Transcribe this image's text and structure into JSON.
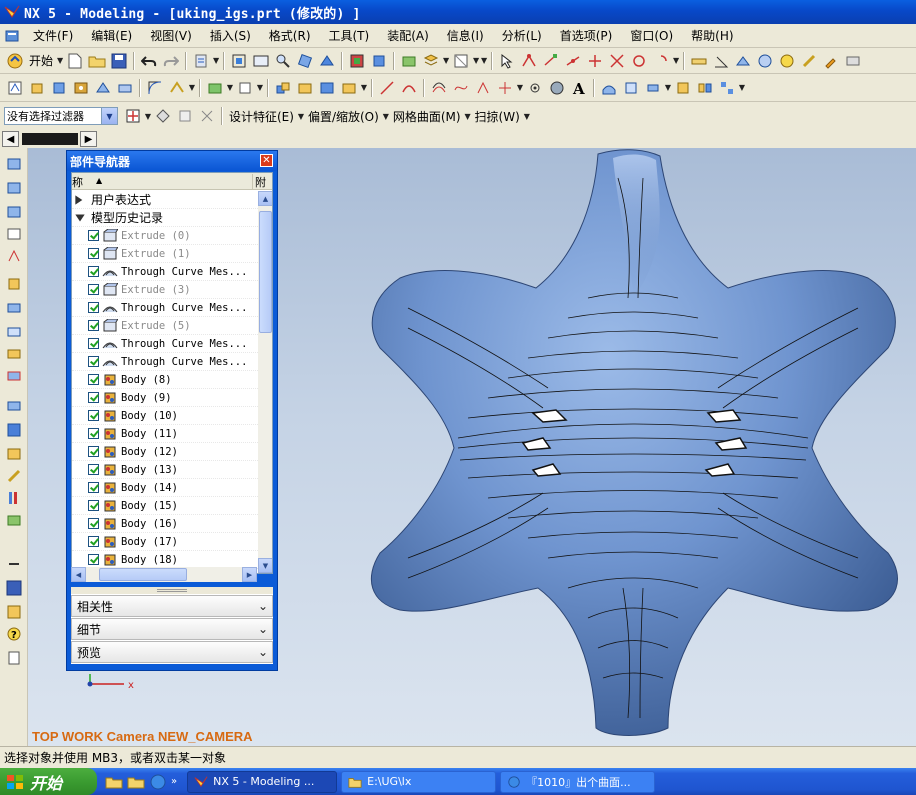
{
  "window": {
    "title": "NX 5 - Modeling - [uking_igs.prt  (修改的) ]"
  },
  "menubar": {
    "items": [
      "文件(F)",
      "编辑(E)",
      "视图(V)",
      "插入(S)",
      "格式(R)",
      "工具(T)",
      "装配(A)",
      "信息(I)",
      "分析(L)",
      "首选项(P)",
      "窗口(O)",
      "帮助(H)"
    ]
  },
  "toolbar2": {
    "start_label": "开始"
  },
  "toolbar4": {
    "filter_value": "没有选择过滤器",
    "design_feature": "设计特征(E)",
    "offset_scale": "偏置/缩放(O)",
    "mesh_surface": "网格曲面(M)",
    "sweep": "扫掠(W)"
  },
  "navigator": {
    "title": "部件导航器",
    "col_name": "称",
    "col_attached": "附",
    "groups": [
      {
        "label": "用户表达式"
      },
      {
        "label": "模型历史记录"
      }
    ],
    "features": [
      {
        "label": "Extrude (0)",
        "dim": true,
        "icon": "extrude-icon"
      },
      {
        "label": "Extrude (1)",
        "dim": true,
        "icon": "extrude-icon"
      },
      {
        "label": "Through Curve Mes...",
        "dim": false,
        "icon": "mesh-surface-icon"
      },
      {
        "label": "Extrude (3)",
        "dim": true,
        "icon": "extrude-icon"
      },
      {
        "label": "Through Curve Mes...",
        "dim": false,
        "icon": "mesh-surface-icon"
      },
      {
        "label": "Extrude (5)",
        "dim": true,
        "icon": "extrude-icon"
      },
      {
        "label": "Through Curve Mes...",
        "dim": false,
        "icon": "mesh-surface-icon"
      },
      {
        "label": "Through Curve Mes...",
        "dim": false,
        "icon": "mesh-surface-icon"
      },
      {
        "label": "Body (8)",
        "dim": false,
        "icon": "body-icon"
      },
      {
        "label": "Body (9)",
        "dim": false,
        "icon": "body-icon"
      },
      {
        "label": "Body (10)",
        "dim": false,
        "icon": "body-icon"
      },
      {
        "label": "Body (11)",
        "dim": false,
        "icon": "body-icon"
      },
      {
        "label": "Body (12)",
        "dim": false,
        "icon": "body-icon"
      },
      {
        "label": "Body (13)",
        "dim": false,
        "icon": "body-icon"
      },
      {
        "label": "Body (14)",
        "dim": false,
        "icon": "body-icon"
      },
      {
        "label": "Body (15)",
        "dim": false,
        "icon": "body-icon"
      },
      {
        "label": "Body (16)",
        "dim": false,
        "icon": "body-icon"
      },
      {
        "label": "Body (17)",
        "dim": false,
        "icon": "body-icon"
      },
      {
        "label": "Body (18)",
        "dim": false,
        "icon": "body-icon"
      }
    ],
    "sections": [
      {
        "label": "相关性"
      },
      {
        "label": "细节"
      },
      {
        "label": "预览"
      }
    ]
  },
  "viewport": {
    "camera_label": "TOP WORK Camera NEW_CAMERA",
    "triad_x": "x"
  },
  "statusbar": {
    "prompt": "选择对象并使用 MB3，或者双击某一对象"
  },
  "taskbar": {
    "start_label": "开始",
    "tasks": [
      {
        "label": "NX 5 - Modeling ...",
        "active": true
      },
      {
        "label": "E:\\UG\\lx",
        "active": false
      },
      {
        "label": "『1010』出个曲面...",
        "active": false
      }
    ]
  },
  "colors": {
    "title_bar": "#0a55d3",
    "camera_label": "#d76a12",
    "model_surface": "#6f94cf"
  }
}
